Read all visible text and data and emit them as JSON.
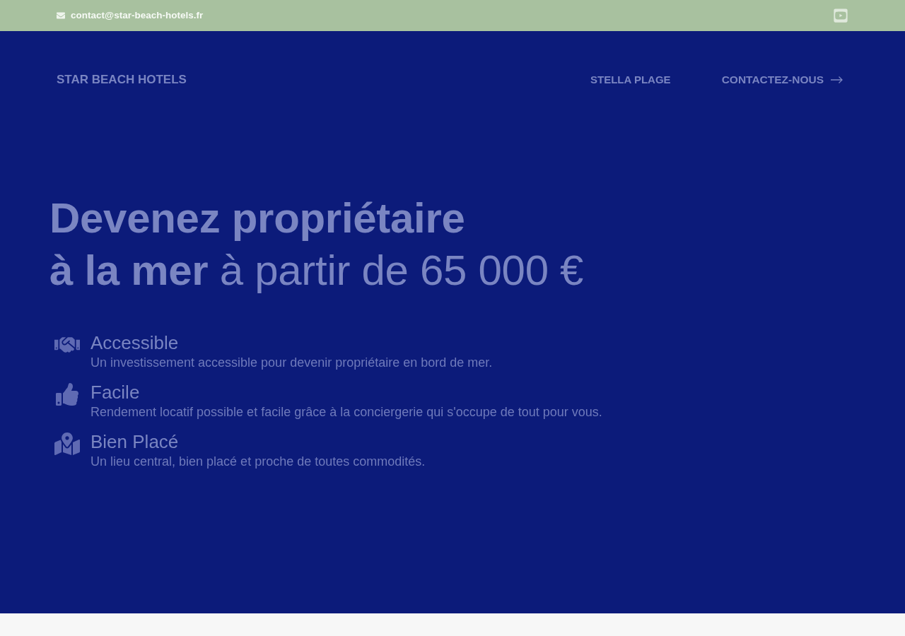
{
  "top_bar": {
    "email": "contact@star-beach-hotels.fr"
  },
  "header": {
    "logo": "STAR BEACH HOTELS",
    "nav": [
      {
        "label": "STELLA PLAGE",
        "kind": "link"
      },
      {
        "label": "CONTACTEZ-NOUS",
        "kind": "cta"
      }
    ]
  },
  "hero": {
    "headline": "**Devenez propriétaire**\n**à la mer** à partir de 65 000 €",
    "features": [
      {
        "title": "Accessible",
        "description": "Un investissement accessible pour devenir propriétaire en bord de mer."
      },
      {
        "title": "Facile",
        "description": "Rendement locatif possible et facile grâce à la conciergerie qui s'occupe de tout pour vous."
      },
      {
        "title": "Bien Placé",
        "description": "Un lieu central, bien placé et proche de toutes commodités."
      }
    ]
  }
}
